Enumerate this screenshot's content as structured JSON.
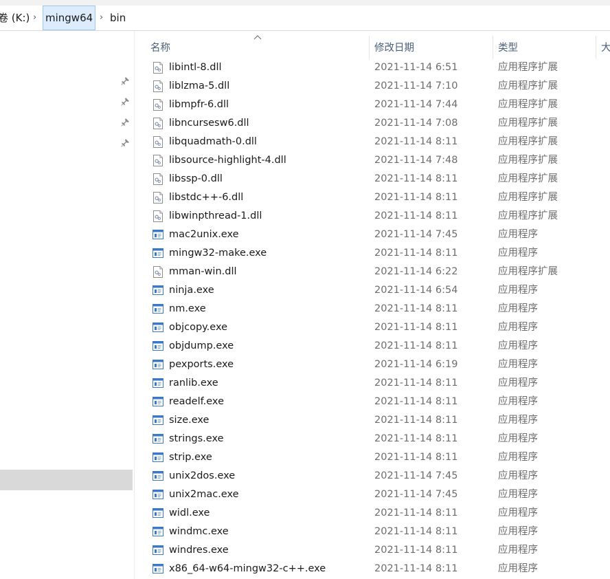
{
  "address": {
    "crumbs": [
      "卷 (K:)",
      "mingw64",
      "bin"
    ]
  },
  "columns": {
    "name": "名称",
    "date": "修改日期",
    "type": "类型",
    "size": "大"
  },
  "files": [
    {
      "name": "libintl-8.dll",
      "date": "2021-11-14 6:51",
      "type": "应用程序扩展",
      "icon": "dll-file-icon"
    },
    {
      "name": "liblzma-5.dll",
      "date": "2021-11-14 7:10",
      "type": "应用程序扩展",
      "icon": "dll-file-icon"
    },
    {
      "name": "libmpfr-6.dll",
      "date": "2021-11-14 7:44",
      "type": "应用程序扩展",
      "icon": "dll-file-icon"
    },
    {
      "name": "libncursesw6.dll",
      "date": "2021-11-14 7:08",
      "type": "应用程序扩展",
      "icon": "dll-file-icon"
    },
    {
      "name": "libquadmath-0.dll",
      "date": "2021-11-14 8:11",
      "type": "应用程序扩展",
      "icon": "dll-file-icon"
    },
    {
      "name": "libsource-highlight-4.dll",
      "date": "2021-11-14 7:48",
      "type": "应用程序扩展",
      "icon": "dll-file-icon"
    },
    {
      "name": "libssp-0.dll",
      "date": "2021-11-14 8:11",
      "type": "应用程序扩展",
      "icon": "dll-file-icon"
    },
    {
      "name": "libstdc++-6.dll",
      "date": "2021-11-14 8:11",
      "type": "应用程序扩展",
      "icon": "dll-file-icon"
    },
    {
      "name": "libwinpthread-1.dll",
      "date": "2021-11-14 8:11",
      "type": "应用程序扩展",
      "icon": "dll-file-icon"
    },
    {
      "name": "mac2unix.exe",
      "date": "2021-11-14 7:45",
      "type": "应用程序",
      "icon": "exe-file-icon"
    },
    {
      "name": "mingw32-make.exe",
      "date": "2021-11-14 8:11",
      "type": "应用程序",
      "icon": "exe-file-icon"
    },
    {
      "name": "mman-win.dll",
      "date": "2021-11-14 6:22",
      "type": "应用程序扩展",
      "icon": "dll-file-icon"
    },
    {
      "name": "ninja.exe",
      "date": "2021-11-14 6:54",
      "type": "应用程序",
      "icon": "exe-file-icon"
    },
    {
      "name": "nm.exe",
      "date": "2021-11-14 8:11",
      "type": "应用程序",
      "icon": "exe-file-icon"
    },
    {
      "name": "objcopy.exe",
      "date": "2021-11-14 8:11",
      "type": "应用程序",
      "icon": "exe-file-icon"
    },
    {
      "name": "objdump.exe",
      "date": "2021-11-14 8:11",
      "type": "应用程序",
      "icon": "exe-file-icon"
    },
    {
      "name": "pexports.exe",
      "date": "2021-11-14 6:19",
      "type": "应用程序",
      "icon": "exe-file-icon"
    },
    {
      "name": "ranlib.exe",
      "date": "2021-11-14 8:11",
      "type": "应用程序",
      "icon": "exe-file-icon"
    },
    {
      "name": "readelf.exe",
      "date": "2021-11-14 8:11",
      "type": "应用程序",
      "icon": "exe-file-icon"
    },
    {
      "name": "size.exe",
      "date": "2021-11-14 8:11",
      "type": "应用程序",
      "icon": "exe-file-icon"
    },
    {
      "name": "strings.exe",
      "date": "2021-11-14 8:11",
      "type": "应用程序",
      "icon": "exe-file-icon"
    },
    {
      "name": "strip.exe",
      "date": "2021-11-14 8:11",
      "type": "应用程序",
      "icon": "exe-file-icon"
    },
    {
      "name": "unix2dos.exe",
      "date": "2021-11-14 7:45",
      "type": "应用程序",
      "icon": "exe-file-icon"
    },
    {
      "name": "unix2mac.exe",
      "date": "2021-11-14 7:45",
      "type": "应用程序",
      "icon": "exe-file-icon"
    },
    {
      "name": "widl.exe",
      "date": "2021-11-14 8:11",
      "type": "应用程序",
      "icon": "exe-file-icon"
    },
    {
      "name": "windmc.exe",
      "date": "2021-11-14 8:11",
      "type": "应用程序",
      "icon": "exe-file-icon"
    },
    {
      "name": "windres.exe",
      "date": "2021-11-14 8:11",
      "type": "应用程序",
      "icon": "exe-file-icon"
    },
    {
      "name": "x86_64-w64-mingw32-c++.exe",
      "date": "2021-11-14 8:11",
      "type": "应用程序",
      "icon": "exe-file-icon"
    }
  ],
  "nav": {
    "pin_icon": "pin-icon",
    "pinned_count": 4
  }
}
